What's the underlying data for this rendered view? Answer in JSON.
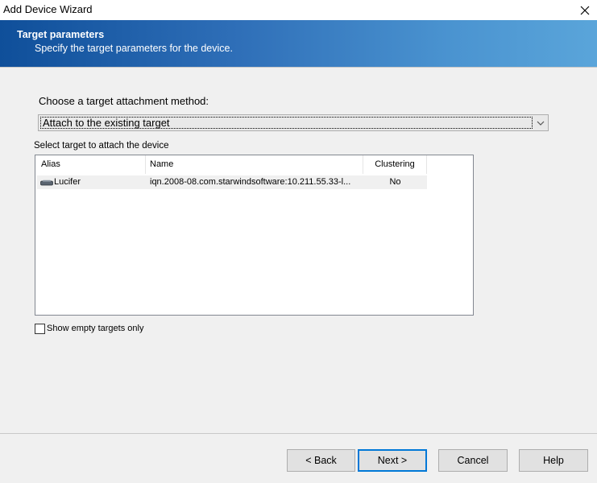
{
  "window": {
    "title": "Add Device Wizard"
  },
  "banner": {
    "title": "Target parameters",
    "subtitle": "Specify the target parameters for the device."
  },
  "method": {
    "label": "Choose a target attachment method:",
    "selected": "Attach to the existing target"
  },
  "targets": {
    "label": "Select target to attach the device",
    "columns": [
      "Alias",
      "Name",
      "Clustering"
    ],
    "rows": [
      {
        "icon": "disk-icon",
        "alias": "Lucifer",
        "name": "iqn.2008-08.com.starwindsoftware:10.211.55.33-l...",
        "clustering": "No"
      }
    ]
  },
  "show_empty": {
    "label": "Show empty targets only",
    "checked": false
  },
  "buttons": {
    "back": "< Back",
    "next": "Next >",
    "cancel": "Cancel",
    "help": "Help"
  },
  "colors": {
    "banner_start": "#0f4f9a",
    "banner_end": "#5aa5da",
    "default_button_border": "#0078d7"
  }
}
